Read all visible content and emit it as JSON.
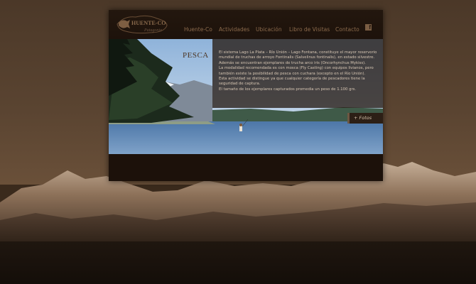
{
  "site": {
    "logo_text": "HUENTE-CO",
    "logo_sub": "Patagonia"
  },
  "nav": {
    "items": [
      {
        "label": "Huente-Co"
      },
      {
        "label": "Actividades"
      },
      {
        "label": "Ubicación"
      },
      {
        "label": "Libro de Visitas"
      },
      {
        "label": "Contacto"
      }
    ],
    "facebook": "f"
  },
  "content": {
    "title": "PESCA",
    "paragraphs": [
      "El sistema Lago La Plata – Río Unión – Lago Fontana, constituye el mayor reservorio mundial de truchas de arroyo Fontinalis (Salvelinus fontinalis), en estado silvestre. Además se encuentran ejemplares de trucha arco iris (Oncorhynchus Mykiss).",
      "La modalidad recomendada es con mosca (Fly Casting) con equipos livianos, pero también existe la posibilidad de pesca con cuchara (excepto en el Río Unión).",
      "Esta actividad se distingue ya que cualquier categoría de pescadores tiene la seguridad de captura.",
      "El tamaño de los ejemplares capturados promedia un peso de 1.100 grs."
    ],
    "fotos_button": "+ Fotos"
  },
  "colors": {
    "panel": "#1e130c",
    "nav_text": "#8b6a4c",
    "body_text": "#d9c8b5"
  }
}
